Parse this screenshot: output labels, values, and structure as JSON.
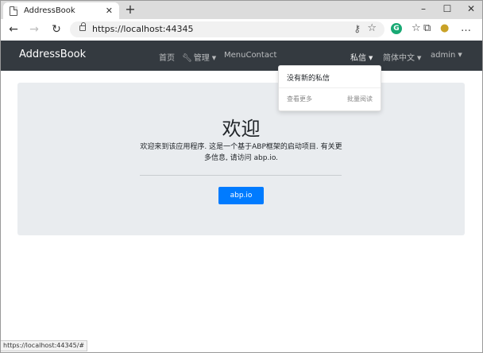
{
  "browser": {
    "tab_title": "AddressBook",
    "tab_close": "✕",
    "new_tab": "+",
    "url": "https://localhost:44345",
    "window_controls": [
      "–",
      "☐",
      "✕"
    ],
    "icons": [
      "page-icon",
      "close-icon",
      "plus-icon",
      "back-icon",
      "forward-icon",
      "refresh-icon",
      "lock-icon",
      "key-icon",
      "star-icon",
      "grammarly-icon",
      "favorites-icon",
      "collections-icon",
      "profile-icon",
      "more-icon"
    ]
  },
  "navbar": {
    "brand": "AddressBook",
    "home": "首页",
    "admin": "管理",
    "menu_contact": "MenuContact",
    "messages": "私信",
    "language": "简体中文",
    "user": "admin",
    "bg_color": "#343a40"
  },
  "dropdown": {
    "empty": "没有新的私信",
    "see_more": "查看更多",
    "mark_read": "批量阅读"
  },
  "jumbotron": {
    "title": "欢迎",
    "text": "欢迎来到该应用程序. 这是一个基于ABP框架的启动项目. 有关更多信息, 请访问 abp.io.",
    "button": "abp.io",
    "button_color": "#007bff"
  },
  "status": {
    "url": "https://localhost:44345/#"
  }
}
